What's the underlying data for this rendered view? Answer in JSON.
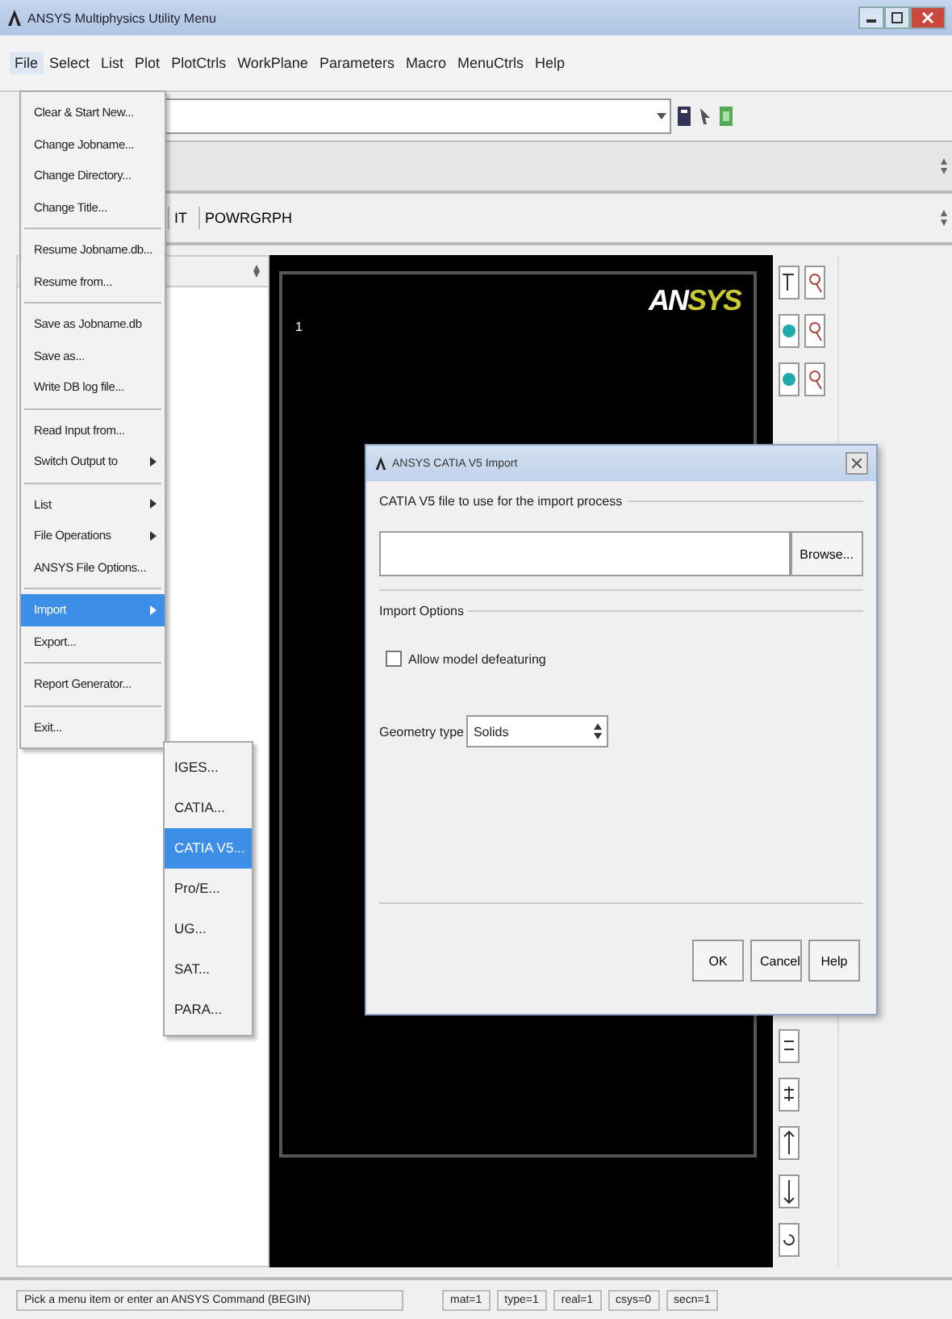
{
  "window": {
    "title": "ANSYS Multiphysics Utility Menu"
  },
  "menubar": [
    {
      "label": "File",
      "selected": true
    },
    {
      "label": "Select",
      "selected": false
    },
    {
      "label": "List",
      "selected": false
    },
    {
      "label": "Plot",
      "selected": false
    },
    {
      "label": "PlotCtrls",
      "selected": false
    },
    {
      "label": "WorkPlane",
      "selected": false
    },
    {
      "label": "Parameters",
      "selected": false
    },
    {
      "label": "Macro",
      "selected": false
    },
    {
      "label": "MenuCtrls",
      "selected": false
    },
    {
      "label": "Help",
      "selected": false
    }
  ],
  "toolbar": {
    "buttons": [
      "IT",
      "POWRGRPH"
    ]
  },
  "file_menu": [
    {
      "kind": "item",
      "label": "Clear & Start New...",
      "submenu": false,
      "selected": false
    },
    {
      "kind": "item",
      "label": "Change Jobname...",
      "submenu": false,
      "selected": false
    },
    {
      "kind": "item",
      "label": "Change Directory...",
      "submenu": false,
      "selected": false
    },
    {
      "kind": "item",
      "label": "Change Title...",
      "submenu": false,
      "selected": false
    },
    {
      "kind": "separator"
    },
    {
      "kind": "item",
      "label": "Resume Jobname.db...",
      "submenu": false,
      "selected": false
    },
    {
      "kind": "item",
      "label": "Resume from...",
      "submenu": false,
      "selected": false
    },
    {
      "kind": "separator"
    },
    {
      "kind": "item",
      "label": "Save as Jobname.db",
      "submenu": false,
      "selected": false
    },
    {
      "kind": "item",
      "label": "Save as...",
      "submenu": false,
      "selected": false
    },
    {
      "kind": "item",
      "label": "Write DB log file...",
      "submenu": false,
      "selected": false
    },
    {
      "kind": "separator"
    },
    {
      "kind": "item",
      "label": "Read Input from...",
      "submenu": false,
      "selected": false
    },
    {
      "kind": "item",
      "label": "Switch Output to",
      "submenu": true,
      "selected": false
    },
    {
      "kind": "separator"
    },
    {
      "kind": "item",
      "label": "List",
      "submenu": true,
      "selected": false
    },
    {
      "kind": "item",
      "label": "File Operations",
      "submenu": true,
      "selected": false
    },
    {
      "kind": "item",
      "label": "ANSYS File Options...",
      "submenu": false,
      "selected": false
    },
    {
      "kind": "separator"
    },
    {
      "kind": "item",
      "label": "Import",
      "submenu": true,
      "selected": true
    },
    {
      "kind": "item",
      "label": "Export...",
      "submenu": false,
      "selected": false
    },
    {
      "kind": "separator"
    },
    {
      "kind": "item",
      "label": "Report Generator...",
      "submenu": false,
      "selected": false
    },
    {
      "kind": "separator"
    },
    {
      "kind": "item",
      "label": "Exit...",
      "submenu": false,
      "selected": false
    }
  ],
  "import_submenu": [
    {
      "label": "IGES...",
      "selected": false
    },
    {
      "label": "CATIA...",
      "selected": false
    },
    {
      "label": "CATIA V5...",
      "selected": true
    },
    {
      "label": "Pro/E...",
      "selected": false
    },
    {
      "label": "UG...",
      "selected": false
    },
    {
      "label": "SAT...",
      "selected": false
    },
    {
      "label": "PARA...",
      "selected": false
    }
  ],
  "graphics": {
    "window_number": "1",
    "logo_left": "AN",
    "logo_right": "SYS"
  },
  "dialog": {
    "title": "ANSYS CATIA V5 Import",
    "file_group": "CATIA V5 file to use for the import process",
    "browse": "Browse...",
    "options_group": "Import Options",
    "checkbox": {
      "label": "Allow model defeaturing",
      "checked": false
    },
    "geometry_label": "Geometry type",
    "geometry_value": "Solids",
    "buttons": [
      "OK",
      "Cancel",
      "Help"
    ]
  },
  "status_bar": [
    "Pick a menu item or enter an ANSYS Command (BEGIN)",
    "mat=1",
    "type=1",
    "real=1",
    "csys=0",
    "secn=1"
  ]
}
